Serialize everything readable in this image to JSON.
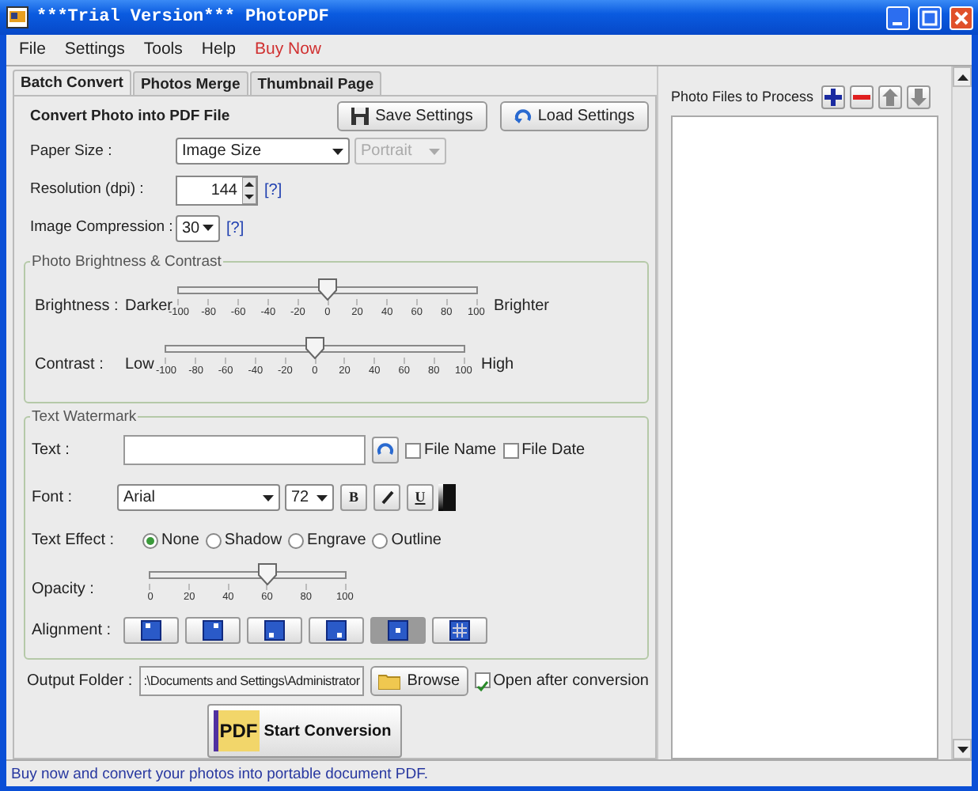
{
  "window": {
    "title": "***Trial Version*** PhotoPDF"
  },
  "menu": [
    {
      "label": "File",
      "kind": "normal"
    },
    {
      "label": "Settings",
      "kind": "normal"
    },
    {
      "label": "Tools",
      "kind": "normal"
    },
    {
      "label": "Help",
      "kind": "normal"
    },
    {
      "label": "Buy Now",
      "kind": "promo"
    }
  ],
  "tabs": [
    {
      "label": "Batch Convert",
      "selected": true
    },
    {
      "label": "Photos Merge",
      "selected": false
    },
    {
      "label": "Thumbnail Page",
      "selected": false
    }
  ],
  "header": {
    "title": "Convert Photo into PDF File",
    "buttons": [
      {
        "label": "Save Settings",
        "kind": "save"
      },
      {
        "label": "Load Settings",
        "kind": "load"
      }
    ]
  },
  "paper_size": {
    "label": "Paper Size :",
    "value": "Image Size",
    "orientation": {
      "value": "Portrait",
      "disabled": true
    }
  },
  "resolution": {
    "label": "Resolution (dpi) :",
    "value": "144",
    "help": "[?]"
  },
  "compression": {
    "label": "Image Compression :",
    "value": "30",
    "help": "[?]"
  },
  "brightness_contrast": {
    "title": "Photo Brightness & Contrast",
    "sliders": [
      {
        "label": "Brightness :",
        "low": "Darker",
        "high": "Brighter",
        "level": 0.5,
        "ticks": [
          "-100",
          "-80",
          "-60",
          "-40",
          "-20",
          "0",
          "20",
          "40",
          "60",
          "80",
          "100"
        ]
      },
      {
        "label": "Contrast :",
        "low": "Low",
        "high": "High",
        "level": 0.5,
        "ticks": [
          "-100",
          "-80",
          "-60",
          "-40",
          "-20",
          "0",
          "20",
          "40",
          "60",
          "80",
          "100"
        ]
      }
    ]
  },
  "watermark": {
    "title": "Text Watermark",
    "text": {
      "label": "Text :"
    },
    "checkboxes": [
      {
        "label": "File Name",
        "checked": false
      },
      {
        "label": "File Date",
        "checked": false
      }
    ],
    "font": {
      "label": "Font :",
      "family": "Arial",
      "size": "72",
      "styles": [
        {
          "kind": "bold",
          "label": "B"
        },
        {
          "kind": "italic"
        },
        {
          "kind": "underline",
          "label": "U"
        },
        {
          "kind": "color"
        }
      ]
    },
    "effect": {
      "label": "Text Effect :",
      "options": [
        {
          "label": "None",
          "selected": true
        },
        {
          "label": "Shadow",
          "selected": false
        },
        {
          "label": "Engrave",
          "selected": false
        },
        {
          "label": "Outline",
          "selected": false
        }
      ]
    },
    "opacity": {
      "label": "Opacity :",
      "level": 0.6,
      "ticks": [
        "0",
        "20",
        "40",
        "60",
        "80",
        "100"
      ]
    },
    "alignment": {
      "label": "Alignment :",
      "options": [
        {
          "kind": "top-left",
          "selected": false
        },
        {
          "kind": "top-right",
          "selected": false
        },
        {
          "kind": "bottom-left",
          "selected": false
        },
        {
          "kind": "bottom-right",
          "selected": false
        },
        {
          "kind": "center",
          "selected": true
        },
        {
          "kind": "tile",
          "selected": false
        }
      ]
    }
  },
  "output": {
    "label": "Output Folder :",
    "value": ":\\Documents and Settings\\Administrator",
    "browse": "Browse",
    "open_after": {
      "label": "Open after conversion",
      "checked": true
    }
  },
  "start": {
    "icon_text": "PDF",
    "label": "Start Conversion"
  },
  "files": {
    "title": "Photo Files to Process",
    "tools": [
      {
        "kind": "add"
      },
      {
        "kind": "remove"
      },
      {
        "kind": "up"
      },
      {
        "kind": "down"
      }
    ]
  },
  "status_bar": "Buy now and convert your photos into portable document PDF."
}
